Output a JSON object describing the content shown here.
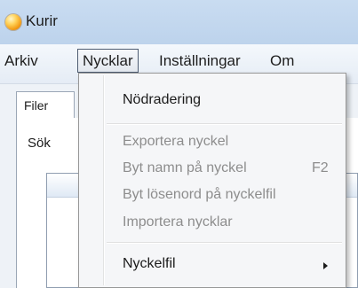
{
  "window": {
    "title": "Kurir",
    "icon": "app-orb-icon"
  },
  "menubar": {
    "items": [
      {
        "label": "Arkiv"
      },
      {
        "label": "Nycklar",
        "state": "open"
      },
      {
        "label": "Inställningar"
      },
      {
        "label": "Om"
      }
    ]
  },
  "main": {
    "tab_label": "Filer",
    "search_label": "Sök"
  },
  "dropdown": {
    "items": [
      {
        "label": "Nödradering",
        "enabled": true
      },
      {
        "label": "Exportera nyckel",
        "enabled": false
      },
      {
        "label": "Byt namn på nyckel",
        "shortcut": "F2",
        "enabled": false
      },
      {
        "label": "Byt lösenord på nyckelfil",
        "enabled": false
      },
      {
        "label": "Importera nycklar",
        "enabled": false
      },
      {
        "label": "Nyckelfil",
        "enabled": true,
        "submenu": true,
        "submenu_icon": "chevron-right-icon"
      }
    ]
  },
  "colors": {
    "titlebar": "#c9dcf1",
    "menubar": "#eef3f9",
    "menu_bg": "#f5f6f8",
    "disabled_text": "#8d8d8d",
    "enabled_text": "#1b1b1b"
  }
}
